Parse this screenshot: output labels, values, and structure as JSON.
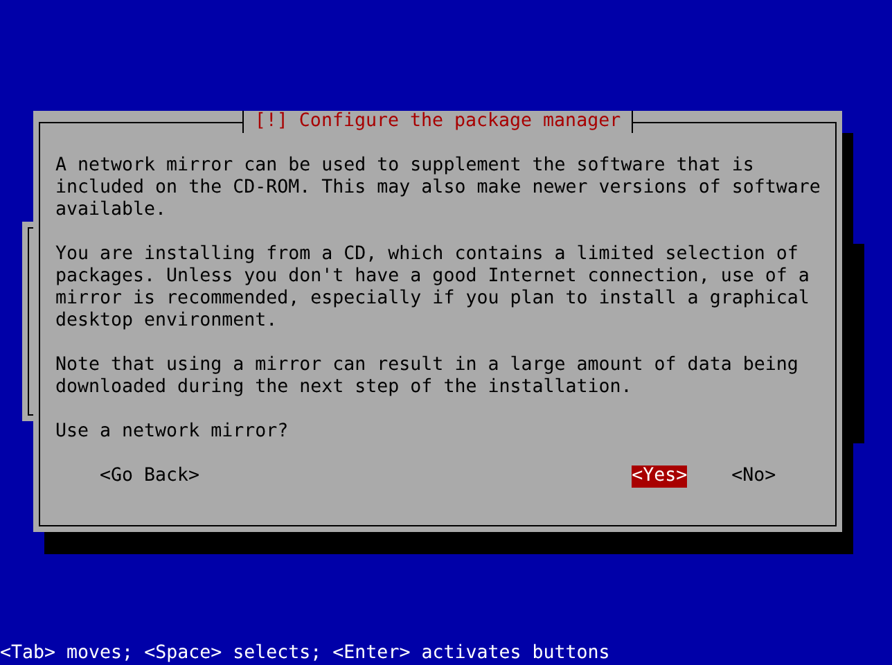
{
  "dialog": {
    "title": "[!] Configure the package manager",
    "paragraphs": [
      [
        "A network mirror can be used to supplement the software that is",
        "included on the CD-ROM. This may also make newer versions of software",
        "available."
      ],
      [
        "You are installing from a CD, which contains a limited selection of",
        "packages. Unless you don't have a good Internet connection, use of a",
        "mirror is recommended, especially if you plan to install a graphical",
        "desktop environment."
      ],
      [
        "Note that using a mirror can result in a large amount of data being",
        "downloaded during the next step of the installation."
      ],
      [
        "Use a network mirror?"
      ]
    ],
    "buttons": [
      {
        "label": "<Go Back>",
        "selected": false
      },
      {
        "label": "<Yes>",
        "selected": true
      },
      {
        "label": "<No>",
        "selected": false
      }
    ]
  },
  "help_line": "<Tab> moves; <Space> selects; <Enter> activates buttons"
}
